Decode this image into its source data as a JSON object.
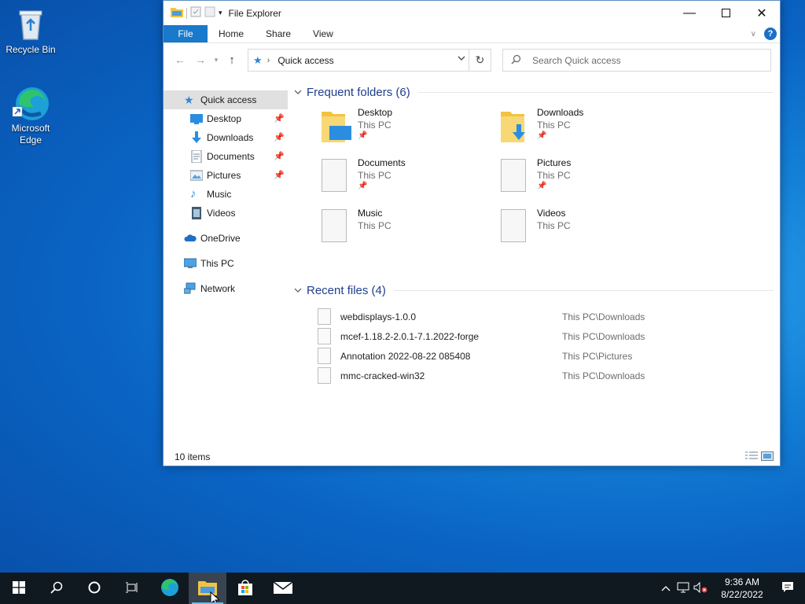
{
  "desktop": {
    "icons": [
      {
        "label": "Recycle Bin"
      },
      {
        "label": "Microsoft Edge"
      }
    ]
  },
  "window": {
    "title": "File Explorer",
    "ribbon_tabs": [
      "File",
      "Home",
      "Share",
      "View"
    ],
    "help": "?",
    "address": {
      "crumb": "Quick access"
    },
    "search": {
      "placeholder": "Search Quick access"
    },
    "sidebar": {
      "quick_access": "Quick access",
      "pinned": [
        {
          "label": "Desktop",
          "icon": "desktop-icon"
        },
        {
          "label": "Downloads",
          "icon": "downloads-icon"
        },
        {
          "label": "Documents",
          "icon": "documents-icon"
        },
        {
          "label": "Pictures",
          "icon": "pictures-icon"
        }
      ],
      "others": [
        {
          "label": "Music",
          "icon": "music-icon"
        },
        {
          "label": "Videos",
          "icon": "videos-icon"
        }
      ],
      "onedrive": "OneDrive",
      "this_pc": "This PC",
      "network": "Network"
    },
    "frequent": {
      "header": "Frequent folders (6)",
      "items": [
        {
          "name": "Desktop",
          "loc": "This PC",
          "pinned": true
        },
        {
          "name": "Downloads",
          "loc": "This PC",
          "pinned": true
        },
        {
          "name": "Documents",
          "loc": "This PC",
          "pinned": true
        },
        {
          "name": "Pictures",
          "loc": "This PC",
          "pinned": true
        },
        {
          "name": "Music",
          "loc": "This PC",
          "pinned": false
        },
        {
          "name": "Videos",
          "loc": "This PC",
          "pinned": false
        }
      ]
    },
    "recent": {
      "header": "Recent files (4)",
      "items": [
        {
          "name": "webdisplays-1.0.0",
          "loc": "This PC\\Downloads"
        },
        {
          "name": "mcef-1.18.2-2.0.1-7.1.2022-forge",
          "loc": "This PC\\Downloads"
        },
        {
          "name": "Annotation 2022-08-22 085408",
          "loc": "This PC\\Pictures"
        },
        {
          "name": "mmc-cracked-win32",
          "loc": "This PC\\Downloads"
        }
      ]
    },
    "status": "10 items"
  },
  "taskbar": {
    "time": "9:36 AM",
    "date": "8/22/2022"
  },
  "colors": {
    "accent": "#1979ca",
    "folder": "#f3c33f",
    "taskbar": "#101820"
  }
}
